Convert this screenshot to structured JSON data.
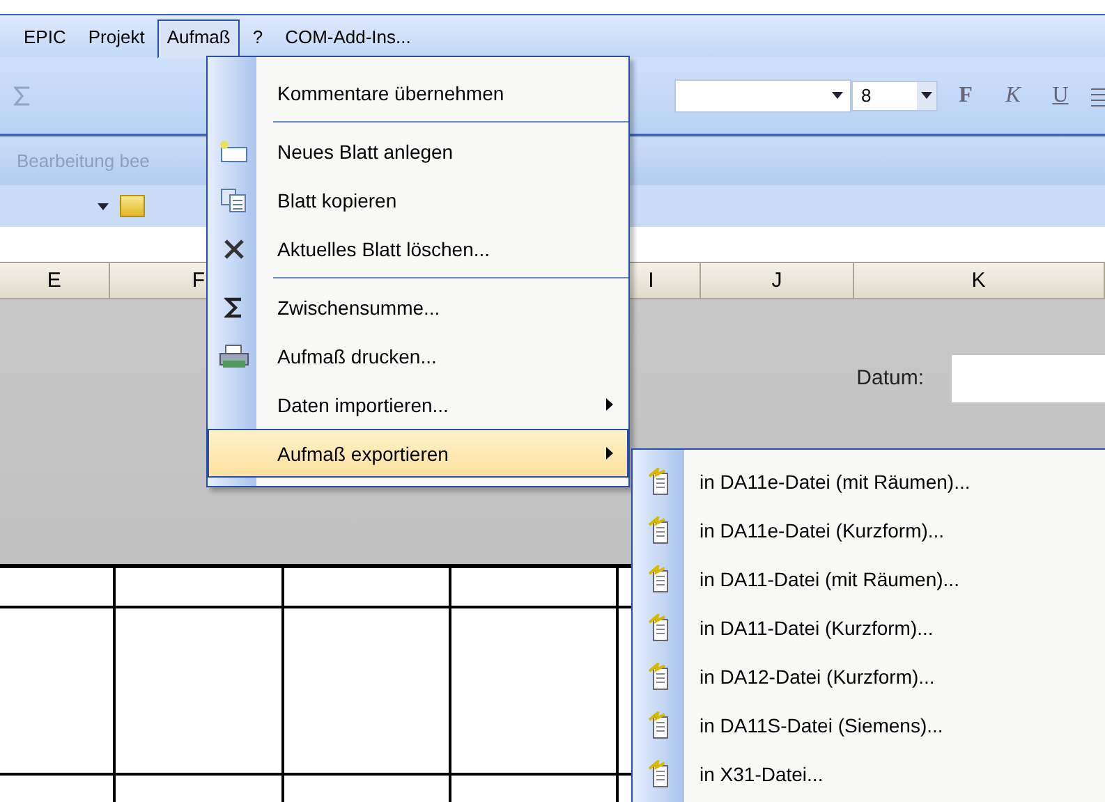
{
  "menubar": [
    {
      "label": "EPIC",
      "selected": false
    },
    {
      "label": "Projekt",
      "selected": false
    },
    {
      "label": "Aufmaß",
      "selected": true
    },
    {
      "label": "?",
      "selected": false
    },
    {
      "label": "COM-Add-Ins...",
      "selected": false
    }
  ],
  "toolbar": {
    "font_size": "8",
    "format_buttons": [
      {
        "label": "F",
        "kind": "bold"
      },
      {
        "label": "K",
        "kind": "italic"
      },
      {
        "label": "U",
        "kind": "underline"
      }
    ]
  },
  "task_bar": {
    "label": "Bearbeitung bee"
  },
  "columns": [
    "E",
    "F",
    "I",
    "J",
    "K"
  ],
  "sheet": {
    "date_label": "Datum:"
  },
  "menu": {
    "sections": [
      {
        "items": [
          {
            "label": "Kommentare übernehmen",
            "kind": "plain",
            "submenu": false,
            "selected": false
          }
        ]
      },
      {
        "items": [
          {
            "label": "Neues Blatt anlegen",
            "kind": "new",
            "submenu": false,
            "selected": false
          },
          {
            "label": "Blatt kopieren",
            "kind": "copy",
            "submenu": false,
            "selected": false
          },
          {
            "label": "Aktuelles Blatt löschen...",
            "kind": "delete",
            "submenu": false,
            "selected": false
          }
        ]
      },
      {
        "items": [
          {
            "label": "Zwischensumme...",
            "kind": "sum",
            "submenu": false,
            "selected": false
          },
          {
            "label": "Aufmaß drucken...",
            "kind": "print",
            "submenu": false,
            "selected": false
          },
          {
            "label": "Daten importieren...",
            "kind": "plain",
            "submenu": true,
            "selected": false
          },
          {
            "label": "Aufmaß exportieren",
            "kind": "plain",
            "submenu": true,
            "selected": true
          }
        ]
      }
    ]
  },
  "submenu": {
    "items": [
      {
        "label": "in DA11e-Datei (mit Räumen)...",
        "kind": "export"
      },
      {
        "label": "in DA11e-Datei (Kurzform)...",
        "kind": "export"
      },
      {
        "label": "in DA11-Datei (mit Räumen)...",
        "kind": "export"
      },
      {
        "label": "in DA11-Datei (Kurzform)...",
        "kind": "export"
      },
      {
        "label": "in DA12-Datei (Kurzform)...",
        "kind": "export"
      },
      {
        "label": "in DA11S-Datei (Siemens)...",
        "kind": "export"
      },
      {
        "label": "in X31-Datei...",
        "kind": "export"
      }
    ]
  }
}
